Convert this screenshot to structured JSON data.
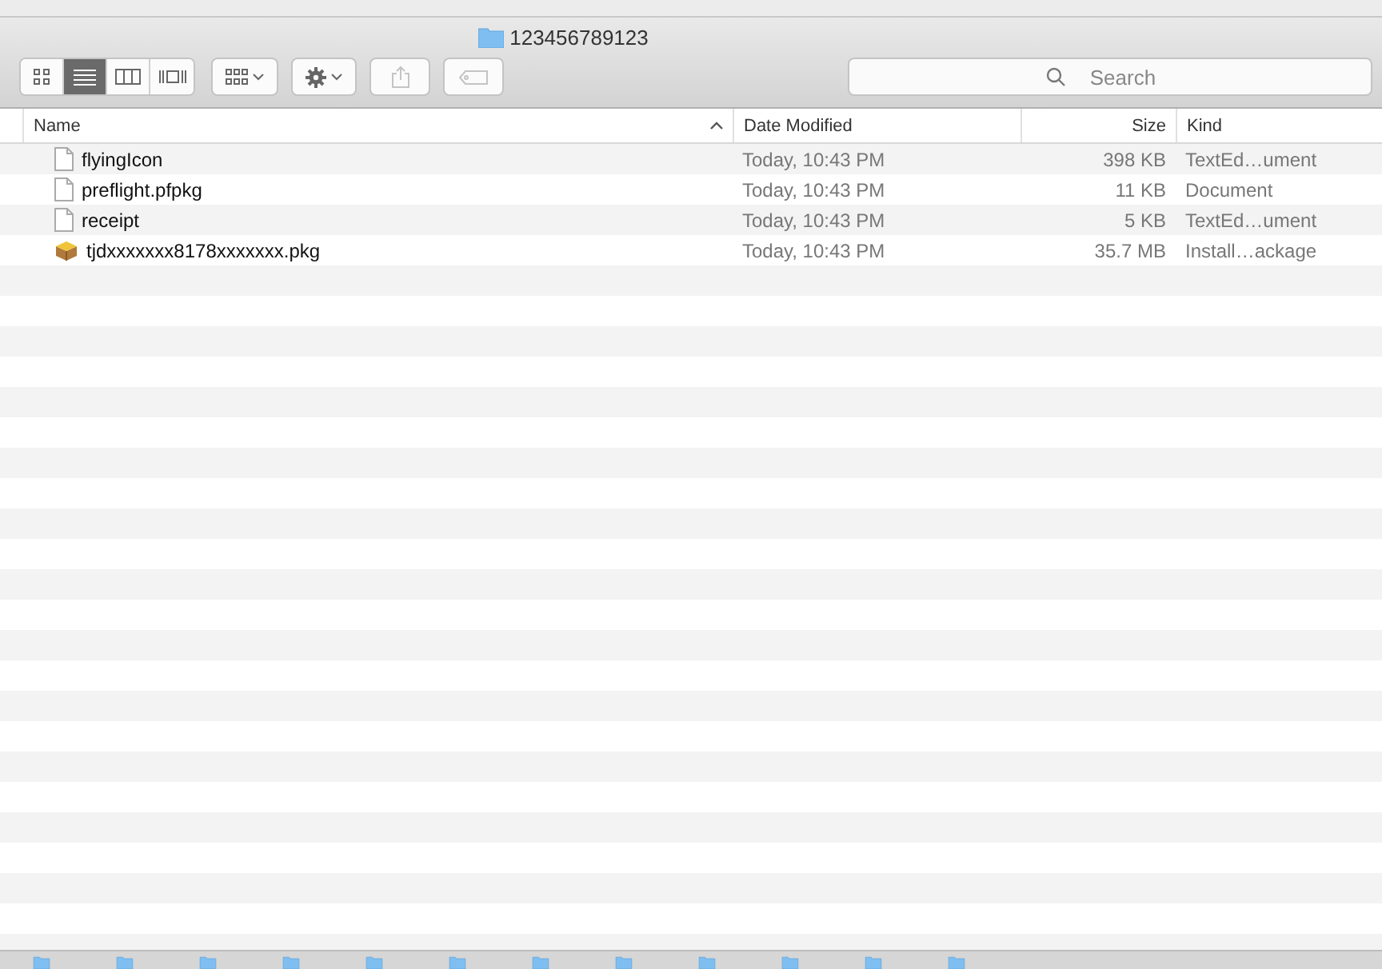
{
  "window": {
    "title": "123456789123"
  },
  "toolbar": {
    "view_modes": [
      {
        "kind": "icons",
        "selected": false
      },
      {
        "kind": "list",
        "selected": true
      },
      {
        "kind": "columns",
        "selected": false
      },
      {
        "kind": "coverflow",
        "selected": false
      }
    ],
    "buttons": [
      {
        "kind": "arrange",
        "disabled": false
      },
      {
        "kind": "action",
        "disabled": false
      },
      {
        "kind": "share",
        "disabled": true
      },
      {
        "kind": "tags",
        "disabled": true
      }
    ],
    "search": {
      "placeholder": "Search"
    }
  },
  "table": {
    "columns": [
      {
        "label": "Name",
        "sorted": true
      },
      {
        "label": "Date Modified",
        "sorted": false
      },
      {
        "label": "Size",
        "sorted": false
      },
      {
        "label": "Kind",
        "sorted": false
      }
    ],
    "rows": [
      {
        "kind": "document",
        "name": "flyingIcon",
        "date": "Today, 10:43 PM",
        "size": "398 KB",
        "type": "TextEd…ument"
      },
      {
        "kind": "document",
        "name": "preflight.pfpkg",
        "date": "Today, 10:43 PM",
        "size": "11 KB",
        "type": "Document"
      },
      {
        "kind": "document",
        "name": "receipt",
        "date": "Today, 10:43 PM",
        "size": "5 KB",
        "type": "TextEd…ument"
      },
      {
        "kind": "package",
        "name": "tjdxxxxxxx8178xxxxxxx.pkg",
        "date": "Today, 10:43 PM",
        "size": "35.7 MB",
        "type": "Install…ackage"
      }
    ]
  }
}
